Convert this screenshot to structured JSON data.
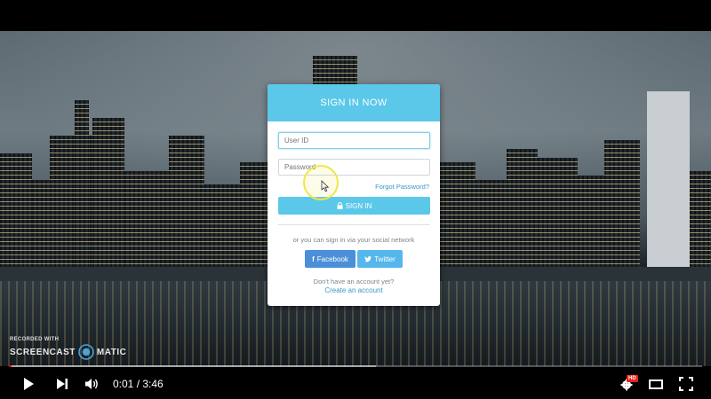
{
  "login": {
    "header": "SIGN IN NOW",
    "userid_placeholder": "User ID",
    "password_placeholder": "Password",
    "forgot_link": "Forgot Password?",
    "signin_label": "SIGN IN",
    "social_caption": "or you can sign in via your social network",
    "facebook_label": "Facebook",
    "twitter_label": "Twitter",
    "no_account_text": "Don't have an account yet?",
    "create_account_link": "Create an account"
  },
  "watermark": {
    "recorded_with": "RECORDED WITH",
    "brand_left": "SCREENCAST",
    "brand_right": "MATIC"
  },
  "player": {
    "current_time": "0:01",
    "duration": "3:46",
    "time_display": "0:01 / 3:46",
    "progress": 0.004,
    "buffered": 0.53,
    "hd_badge": "HD"
  },
  "colors": {
    "accent": "#5bc8ea",
    "facebook": "#4a8fd8",
    "twitter": "#55b7ec",
    "link": "#3a97c9",
    "progress_red": "#ff0000"
  },
  "icons": [
    "lock-icon",
    "facebook-icon",
    "twitter-icon",
    "play-icon",
    "next-icon",
    "volume-icon",
    "settings-icon",
    "theater-mode-icon",
    "fullscreen-icon"
  ]
}
